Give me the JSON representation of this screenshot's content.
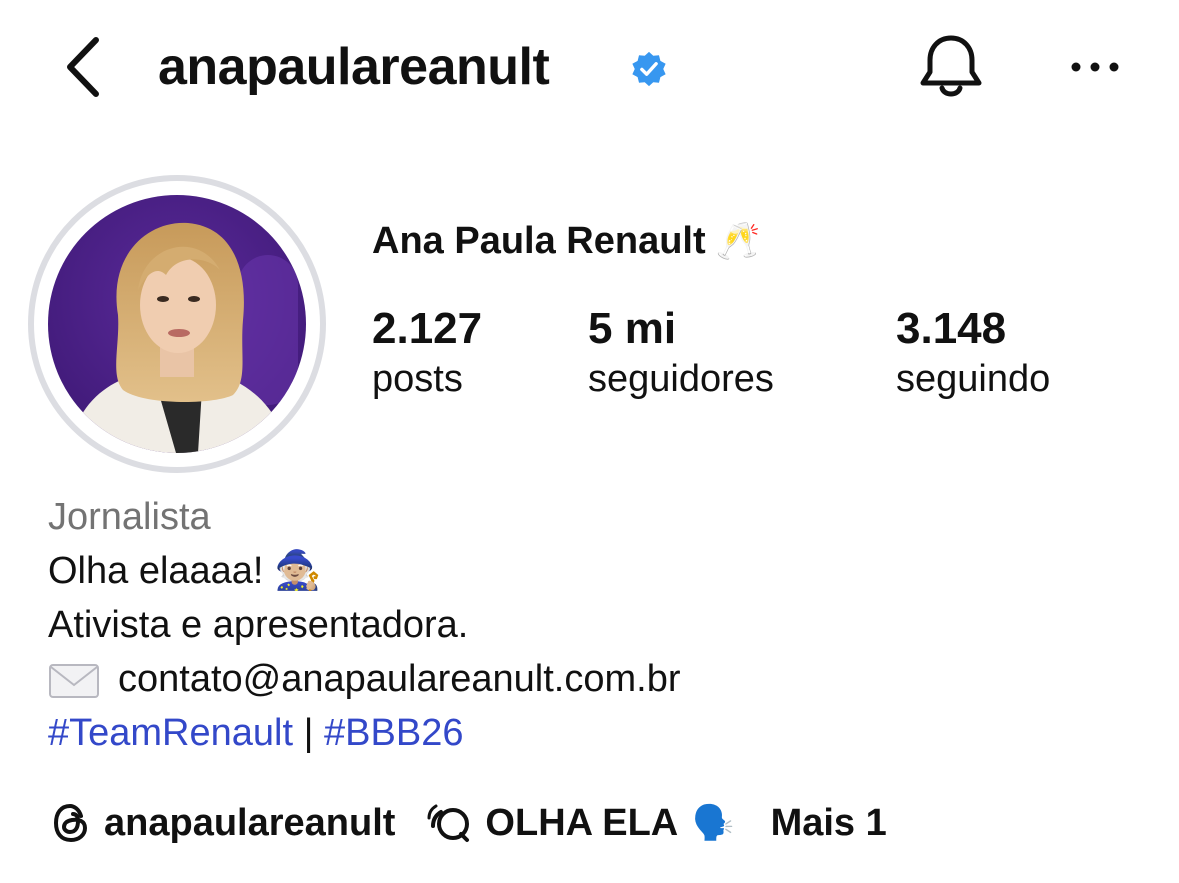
{
  "header": {
    "username": "anapaulareanult",
    "verified": true,
    "icons": {
      "back": "chevron-left-icon",
      "notifications": "bell-icon",
      "more": "more-horizontal-icon",
      "verified": "verified-badge-icon"
    }
  },
  "profile": {
    "full_name": "Ana Paula Renault",
    "name_emoji": "🥂",
    "stats": [
      {
        "value": "2.127",
        "label": "posts"
      },
      {
        "value": "5 mi",
        "label": "seguidores"
      },
      {
        "value": "3.148",
        "label": "seguindo"
      }
    ]
  },
  "bio": {
    "category": "Jornalista",
    "line1": "Olha elaaaa!",
    "line1_emoji": "🧙🏼",
    "line2": "Ativista e apresentadora.",
    "email": "contato@anapaulareanult.com.br",
    "hashtag1": "#TeamRenault",
    "separator": "|",
    "hashtag2": "#BBB26"
  },
  "links": {
    "threads_handle": "anapaulareanult",
    "channel_label": "OLHA ELA",
    "channel_emoji": "🗣️",
    "more_label": "Mais 1",
    "icons": {
      "threads": "threads-icon",
      "channel": "broadcast-chat-icon"
    }
  },
  "colors": {
    "accent_link": "#3348c9",
    "verified_blue": "#3797f0",
    "category_gray": "#737373",
    "avatar_bg": "#4a1f86"
  }
}
